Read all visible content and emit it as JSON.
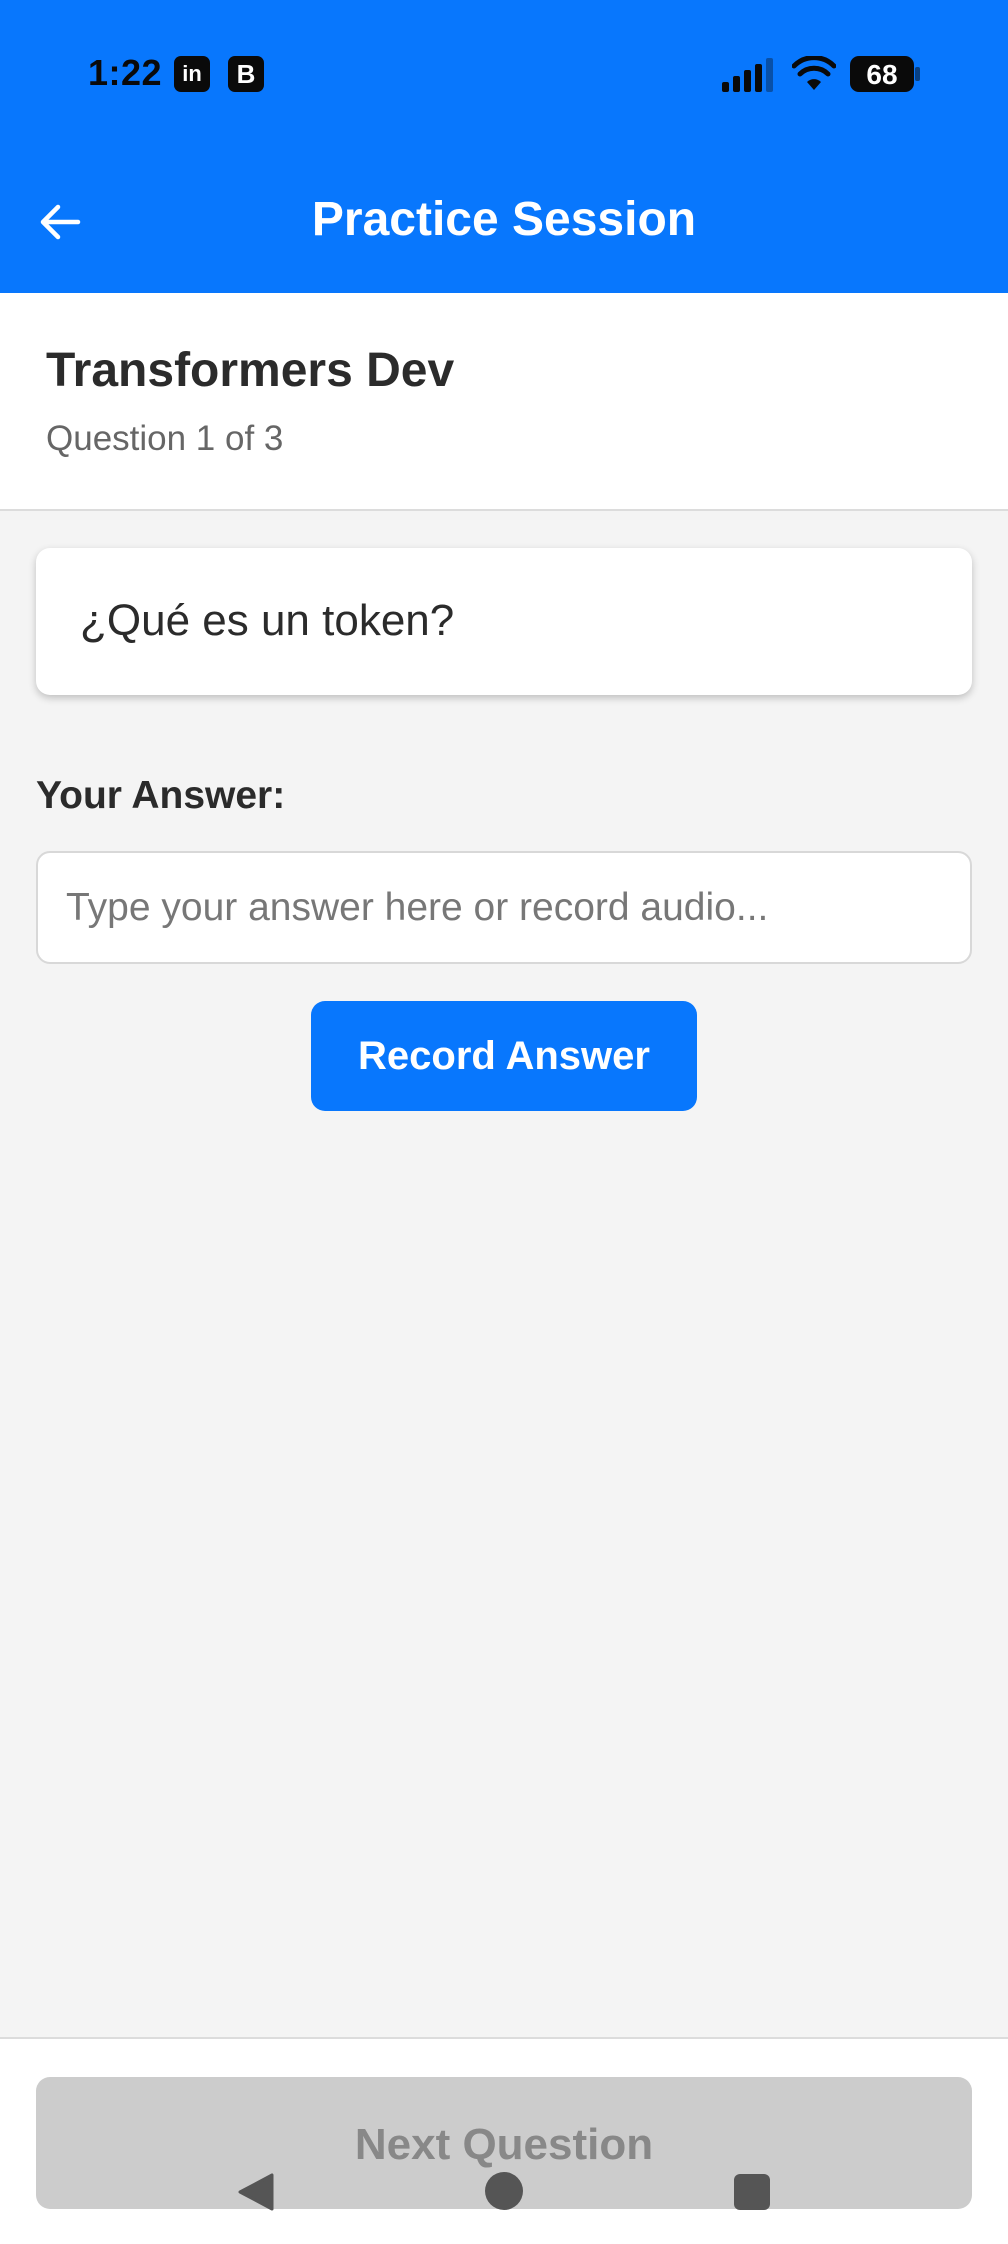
{
  "status_bar": {
    "time": "1:22",
    "linkedin_icon": "in",
    "b_icon": "B",
    "battery_level": "68",
    "icons": [
      "linkedin-icon",
      "b-app-icon",
      "signal-icon",
      "wifi-icon",
      "battery-icon"
    ]
  },
  "header": {
    "title": "Practice Session",
    "back_icon": "arrow-left-icon"
  },
  "deck": {
    "title": "Transformers Dev",
    "progress": "Question 1 of 3"
  },
  "question": {
    "text": "¿Qué es un token?"
  },
  "answer": {
    "label": "Your Answer:",
    "placeholder": "Type your answer here or record audio...",
    "value": ""
  },
  "actions": {
    "record_label": "Record Answer",
    "next_label": "Next Question"
  },
  "nav_bar": {
    "icons": [
      "nav-back-icon",
      "nav-home-icon",
      "nav-recent-icon"
    ]
  },
  "colors": {
    "primary": "#0877fd",
    "background": "#f4f4f4",
    "disabled": "#cccccc",
    "text_dark": "#2b2b2b",
    "text_muted": "#666666"
  }
}
